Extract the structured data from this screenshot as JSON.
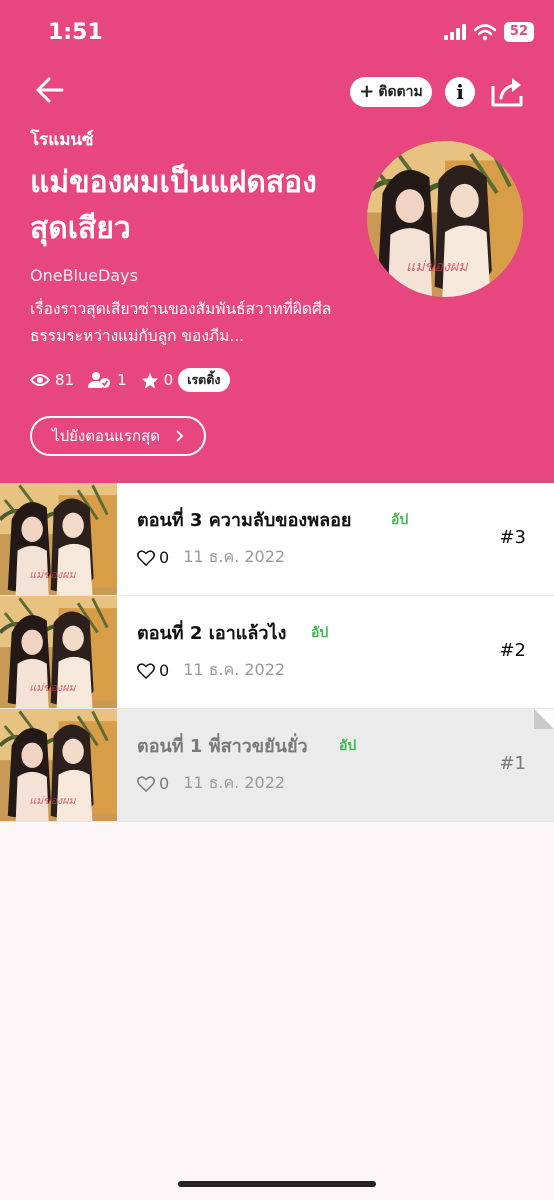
{
  "status_bar": {
    "time": "1:51",
    "battery": "52"
  },
  "header": {
    "follow_label": "ติดตาม",
    "info_label": "i",
    "genre": "โรแมนซ์",
    "title": "แม่ของผมเป็นแฝดสองสุดเสียว",
    "author": "OneBlueDays",
    "description": "เรื่องราวสุดเสียวซ่านของสัมพันธ์สวาทที่ผิดศีลธรรมระหว่างแม่กับลูก ของภีม...",
    "stats": {
      "views": "81",
      "followers": "1",
      "rating": "0",
      "rating_label": "เรตติ้ง"
    },
    "first_episode_label": "ไปยังตอนแรกสุด"
  },
  "episodes": [
    {
      "title": "ตอนที่ 3 ความลับของพลอย",
      "badge": "อัป",
      "likes": "0",
      "date": "11 ธ.ค. 2022",
      "number": "#3"
    },
    {
      "title": "ตอนที่ 2 เอาแล้วไง",
      "badge": "อัป",
      "likes": "0",
      "date": "11 ธ.ค. 2022",
      "number": "#2"
    },
    {
      "title": "ตอนที่ 1 พี่สาวขยันยั่ว",
      "badge": "อัป",
      "likes": "0",
      "date": "11 ธ.ค. 2022",
      "number": "#1"
    }
  ],
  "colors": {
    "header_bg": "#e8467f",
    "new_badge": "#3dbb50"
  }
}
